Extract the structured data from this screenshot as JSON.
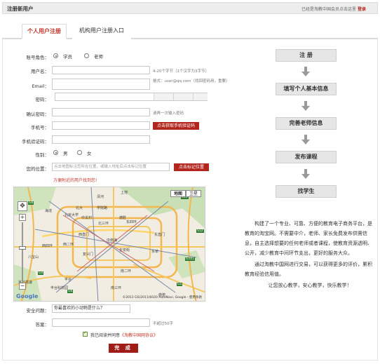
{
  "header": {
    "title": "注册新用户",
    "member_prompt": "已经是淘教中国会员点击这里",
    "login_label": "登录"
  },
  "tabs": [
    {
      "label": "个人用户注册",
      "active": true
    },
    {
      "label": "机构用户注册入口",
      "active": false
    }
  ],
  "form": {
    "role": {
      "label": "账号角色：",
      "options": [
        "学员",
        "老师"
      ],
      "selected": "学员"
    },
    "username": {
      "label": "用户名：",
      "value": "",
      "hint": "4-20个字节（1个汉字为3字节）"
    },
    "email": {
      "label": "Email：",
      "value": "",
      "hint": "格式：user@qq.com（找回密码用，重要）"
    },
    "password": {
      "label": "密码：",
      "value": ""
    },
    "confirm_password": {
      "label": "确认密码：",
      "value": "",
      "hint": "请再一次输入密码"
    },
    "phone": {
      "label": "手机号：",
      "value": "",
      "button": "点击获取手机验证码"
    },
    "sms_code": {
      "label": "手机验证码：",
      "value": ""
    },
    "gender": {
      "label": "性别：",
      "options": [
        "男",
        "女"
      ],
      "selected": "男"
    },
    "location": {
      "label": "您的位置：",
      "placeholder": "点击地图标注您所在位置，或输入地址后点击标记位置",
      "button": "点击标记位置"
    },
    "location_note": "方便附近的用户找到您!",
    "security_question": {
      "label": "安全问题：",
      "value": "你最喜欢的小动物是什么？"
    },
    "answer": {
      "label": "答案：",
      "value": "",
      "hint": "不超过50字"
    },
    "agreement": {
      "checked": true,
      "text": "我已阅读并同意",
      "link": "《淘教中国网协议》"
    },
    "submit_label": "完 成"
  },
  "map": {
    "type_buttons": [
      "地图",
      "卫星"
    ],
    "selected_type": "地图",
    "labels": [
      "上地",
      "清河",
      "北大",
      "学院路",
      "中关村",
      "海淀",
      "北京大学",
      "北三环",
      "德胜",
      "东直门",
      "西直门",
      "西二环",
      "中南海",
      "东四环",
      "复兴门",
      "长安街",
      "西四环",
      "南二环",
      "南三环",
      "丰台",
      "丰台科技园",
      "八宝山",
      "京石高速",
      "东单",
      "南苑"
    ],
    "route_labels": [
      "G6",
      "G6",
      "G4",
      "S50",
      "G101",
      "S12",
      "G1"
    ],
    "copyright": "©2013 GS(2011)6020 AutoNavi, Google - 使用条款"
  },
  "flow": [
    "注 册",
    "填写个人基本信息",
    "完善老师信息",
    "发布课程",
    "找学生"
  ],
  "intro": [
    "构建了一个专业、可靠、方便的教育电子商务平台，是教育的淘宝网。不需要中介，老师、家长免费发布供需信息，自主选择想要的任何老师或者课程，使教育资源透明、公开，减少教育中间环节支出，更好的服务大众。",
    "通过淘教中国网进行交易，可以获得更多的评价，累积教育经验信用值。",
    "让您放心教学，安心教学，快乐教学！"
  ],
  "colors": {
    "accent": "#b3261e",
    "tab_active": "#c0392b",
    "flow_box": "#e6e6e6"
  }
}
